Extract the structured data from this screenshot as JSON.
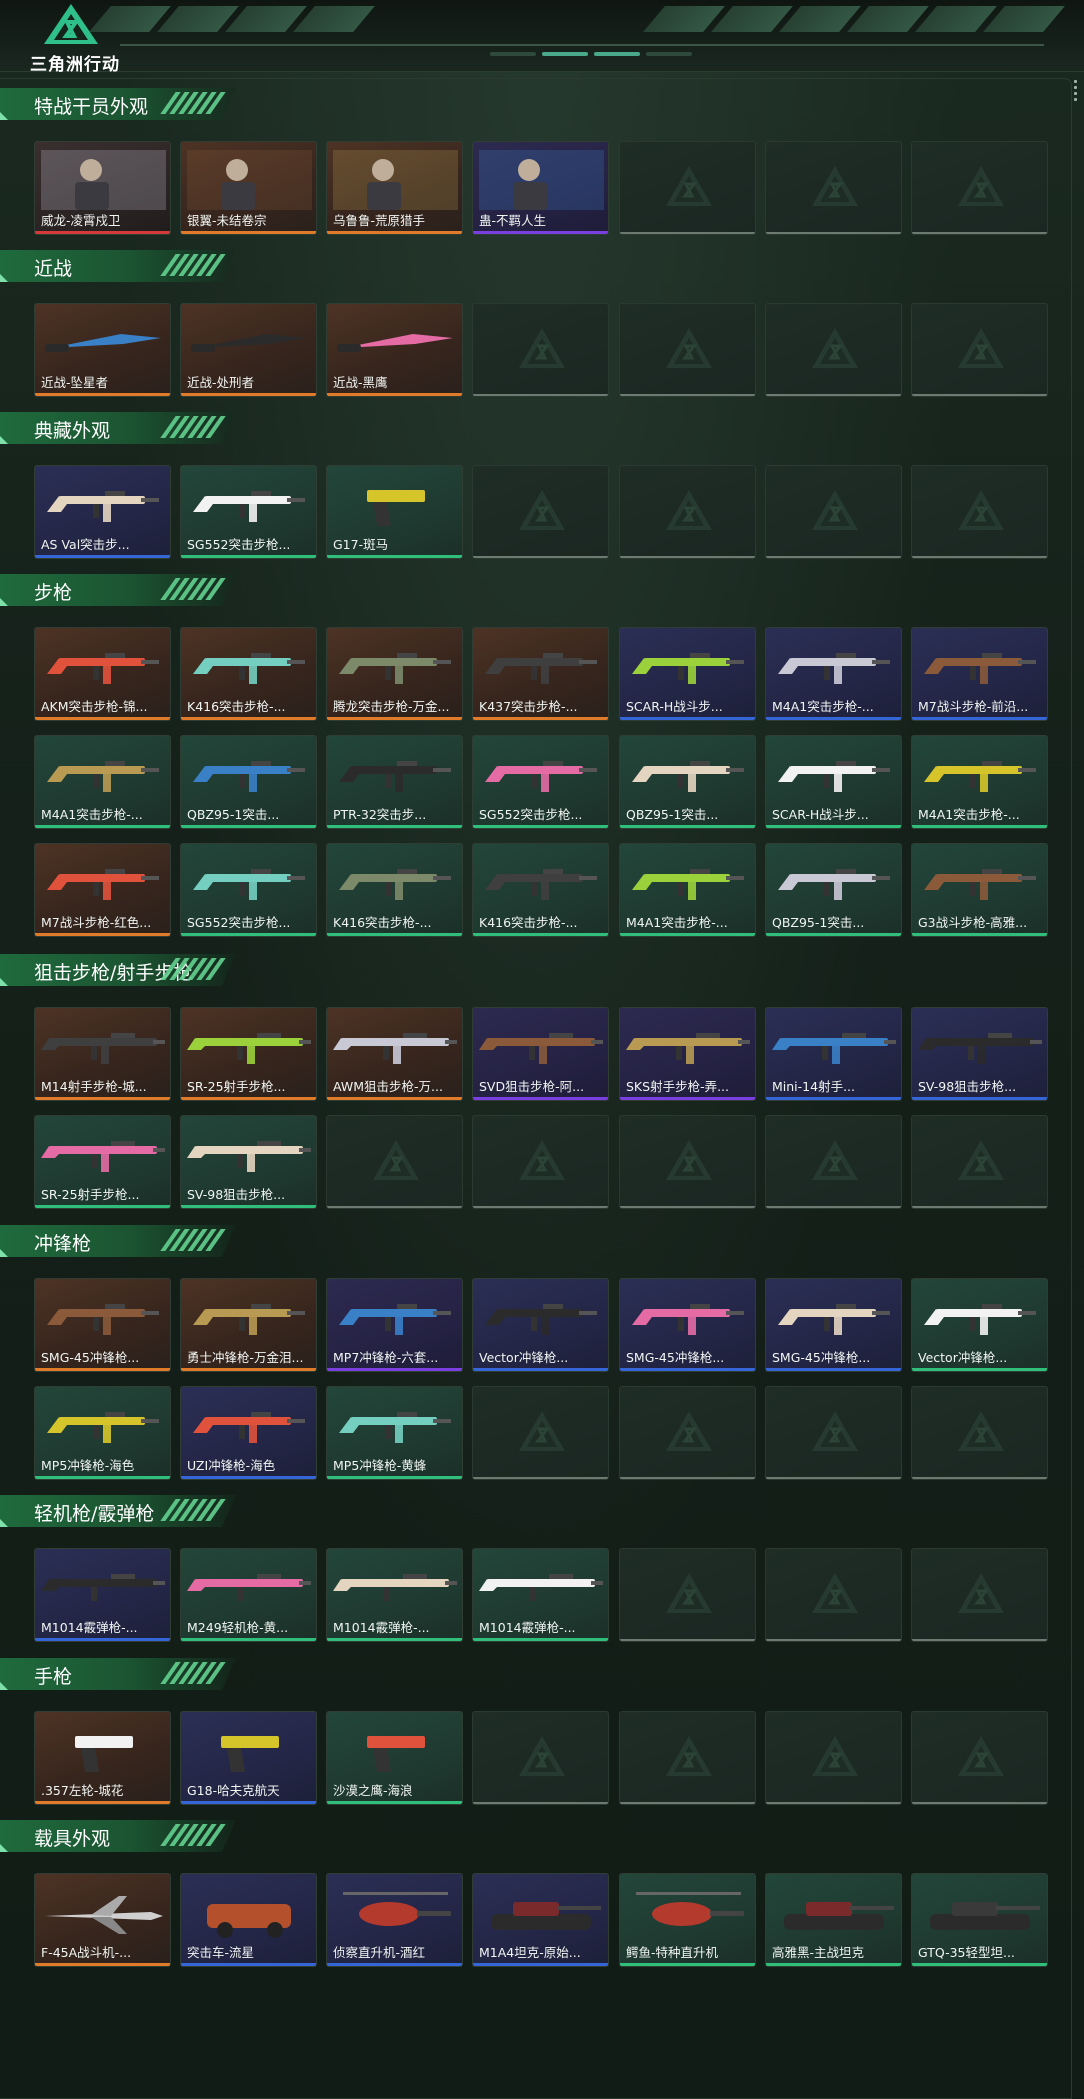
{
  "app": {
    "title": "三角洲行动"
  },
  "icons": {
    "logo": "delta-logo-icon",
    "watermark": "delta-watermark-icon",
    "scroll": "scroll-dots-icon"
  },
  "colors": {
    "rarity_orange": "#e07b2a",
    "rarity_blue": "#3566d8",
    "rarity_green": "#2fbf7a",
    "rarity_red": "#d53a3a",
    "rarity_purple": "#7b3ee0",
    "header_green": "#1f6b3d",
    "background": "#15201a"
  },
  "sections": [
    {
      "title": "特战干员外观",
      "items": [
        {
          "label": "威龙-凌霄戍卫",
          "rarity": "red",
          "kind": "operator"
        },
        {
          "label": "银翼-未结卷宗",
          "rarity": "orange",
          "kind": "operator"
        },
        {
          "label": "乌鲁鲁-荒原猎手",
          "rarity": "orange",
          "kind": "operator"
        },
        {
          "label": "蛊-不羁人生",
          "rarity": "purple",
          "kind": "operator"
        },
        {
          "label": "",
          "rarity": "empty"
        },
        {
          "label": "",
          "rarity": "empty"
        },
        {
          "label": "",
          "rarity": "empty"
        }
      ]
    },
    {
      "title": "近战",
      "items": [
        {
          "label": "近战-坠星者",
          "rarity": "orange",
          "kind": "knife"
        },
        {
          "label": "近战-处刑者",
          "rarity": "orange",
          "kind": "knife"
        },
        {
          "label": "近战-黑鹰",
          "rarity": "orange",
          "kind": "knife"
        },
        {
          "label": "",
          "rarity": "empty"
        },
        {
          "label": "",
          "rarity": "empty"
        },
        {
          "label": "",
          "rarity": "empty"
        },
        {
          "label": "",
          "rarity": "empty"
        }
      ]
    },
    {
      "title": "典藏外观",
      "items": [
        {
          "label": "AS Val突击步...",
          "rarity": "blue",
          "kind": "rifle"
        },
        {
          "label": "SG552突击步枪...",
          "rarity": "green",
          "kind": "rifle"
        },
        {
          "label": "G17-斑马",
          "rarity": "green",
          "kind": "pistol"
        },
        {
          "label": "",
          "rarity": "empty"
        },
        {
          "label": "",
          "rarity": "empty"
        },
        {
          "label": "",
          "rarity": "empty"
        },
        {
          "label": "",
          "rarity": "empty"
        }
      ]
    },
    {
      "title": "步枪",
      "items": [
        {
          "label": "AKM突击步枪-锦...",
          "rarity": "orange",
          "kind": "rifle"
        },
        {
          "label": "K416突击步枪-...",
          "rarity": "orange",
          "kind": "rifle"
        },
        {
          "label": "腾龙突击步枪-万金...",
          "rarity": "orange",
          "kind": "rifle"
        },
        {
          "label": "K437突击步枪-...",
          "rarity": "orange",
          "kind": "rifle"
        },
        {
          "label": "SCAR-H战斗步...",
          "rarity": "blue",
          "kind": "rifle"
        },
        {
          "label": "M4A1突击步枪-...",
          "rarity": "blue",
          "kind": "rifle"
        },
        {
          "label": "M7战斗步枪-前沿...",
          "rarity": "blue",
          "kind": "rifle"
        },
        {
          "label": "M4A1突击步枪-...",
          "rarity": "green",
          "kind": "rifle"
        },
        {
          "label": "QBZ95-1突击...",
          "rarity": "green",
          "kind": "rifle"
        },
        {
          "label": "PTR-32突击步...",
          "rarity": "green",
          "kind": "rifle"
        },
        {
          "label": "SG552突击步枪...",
          "rarity": "green",
          "kind": "rifle"
        },
        {
          "label": "QBZ95-1突击...",
          "rarity": "green",
          "kind": "rifle"
        },
        {
          "label": "SCAR-H战斗步...",
          "rarity": "green",
          "kind": "rifle"
        },
        {
          "label": "M4A1突击步枪-...",
          "rarity": "green",
          "kind": "rifle"
        },
        {
          "label": "M7战斗步枪-红色...",
          "rarity": "orange",
          "kind": "rifle"
        },
        {
          "label": "SG552突击步枪...",
          "rarity": "green",
          "kind": "rifle"
        },
        {
          "label": "K416突击步枪-...",
          "rarity": "green",
          "kind": "rifle"
        },
        {
          "label": "K416突击步枪-...",
          "rarity": "green",
          "kind": "rifle"
        },
        {
          "label": "M4A1突击步枪-...",
          "rarity": "green",
          "kind": "rifle"
        },
        {
          "label": "QBZ95-1突击...",
          "rarity": "green",
          "kind": "rifle"
        },
        {
          "label": "G3战斗步枪-高雅...",
          "rarity": "green",
          "kind": "rifle"
        }
      ]
    },
    {
      "title": "狙击步枪/射手步枪",
      "items": [
        {
          "label": "M14射手步枪-城...",
          "rarity": "orange",
          "kind": "sniper"
        },
        {
          "label": "SR-25射手步枪...",
          "rarity": "orange",
          "kind": "sniper"
        },
        {
          "label": "AWM狙击步枪-万...",
          "rarity": "orange",
          "kind": "sniper"
        },
        {
          "label": "SVD狙击步枪-阿...",
          "rarity": "purple",
          "kind": "sniper"
        },
        {
          "label": "SKS射手步枪-弄...",
          "rarity": "purple",
          "kind": "sniper"
        },
        {
          "label": "Mini-14射手...",
          "rarity": "blue",
          "kind": "sniper"
        },
        {
          "label": "SV-98狙击步枪...",
          "rarity": "blue",
          "kind": "sniper"
        },
        {
          "label": "SR-25射手步枪...",
          "rarity": "green",
          "kind": "sniper"
        },
        {
          "label": "SV-98狙击步枪...",
          "rarity": "green",
          "kind": "sniper"
        },
        {
          "label": "",
          "rarity": "empty"
        },
        {
          "label": "",
          "rarity": "empty"
        },
        {
          "label": "",
          "rarity": "empty"
        },
        {
          "label": "",
          "rarity": "empty"
        },
        {
          "label": "",
          "rarity": "empty"
        }
      ]
    },
    {
      "title": "冲锋枪",
      "items": [
        {
          "label": "SMG-45冲锋枪...",
          "rarity": "orange",
          "kind": "smg"
        },
        {
          "label": "勇士冲锋枪-万金泪...",
          "rarity": "orange",
          "kind": "smg"
        },
        {
          "label": "MP7冲锋枪-六套...",
          "rarity": "purple",
          "kind": "smg"
        },
        {
          "label": "Vector冲锋枪...",
          "rarity": "blue",
          "kind": "smg"
        },
        {
          "label": "SMG-45冲锋枪...",
          "rarity": "blue",
          "kind": "smg"
        },
        {
          "label": "SMG-45冲锋枪...",
          "rarity": "blue",
          "kind": "smg"
        },
        {
          "label": "Vector冲锋枪...",
          "rarity": "green",
          "kind": "smg"
        },
        {
          "label": "MP5冲锋枪-海色",
          "rarity": "green",
          "kind": "smg"
        },
        {
          "label": "UZI冲锋枪-海色",
          "rarity": "blue",
          "kind": "smg"
        },
        {
          "label": "MP5冲锋枪-黄蜂",
          "rarity": "green",
          "kind": "smg"
        },
        {
          "label": "",
          "rarity": "empty"
        },
        {
          "label": "",
          "rarity": "empty"
        },
        {
          "label": "",
          "rarity": "empty"
        },
        {
          "label": "",
          "rarity": "empty"
        }
      ]
    },
    {
      "title": "轻机枪/霰弹枪",
      "items": [
        {
          "label": "M1014霰弹枪-...",
          "rarity": "blue",
          "kind": "shotgun"
        },
        {
          "label": "M249轻机枪-黄...",
          "rarity": "green",
          "kind": "shotgun"
        },
        {
          "label": "M1014霰弹枪-...",
          "rarity": "green",
          "kind": "shotgun"
        },
        {
          "label": "M1014霰弹枪-...",
          "rarity": "green",
          "kind": "shotgun"
        },
        {
          "label": "",
          "rarity": "empty"
        },
        {
          "label": "",
          "rarity": "empty"
        },
        {
          "label": "",
          "rarity": "empty"
        }
      ]
    },
    {
      "title": "手枪",
      "items": [
        {
          "label": ".357左轮-城花",
          "rarity": "orange",
          "kind": "pistol"
        },
        {
          "label": "G18-哈夫克航天",
          "rarity": "blue",
          "kind": "pistol"
        },
        {
          "label": "沙漠之鹰-海浪",
          "rarity": "green",
          "kind": "pistol"
        },
        {
          "label": "",
          "rarity": "empty"
        },
        {
          "label": "",
          "rarity": "empty"
        },
        {
          "label": "",
          "rarity": "empty"
        },
        {
          "label": "",
          "rarity": "empty"
        }
      ]
    },
    {
      "title": "载具外观",
      "items": [
        {
          "label": "F-45A战斗机-...",
          "rarity": "orange",
          "kind": "jet"
        },
        {
          "label": "突击车-流星",
          "rarity": "blue",
          "kind": "car"
        },
        {
          "label": "侦察直升机-酒红",
          "rarity": "blue",
          "kind": "heli"
        },
        {
          "label": "M1A4坦克-原始...",
          "rarity": "blue",
          "kind": "tank"
        },
        {
          "label": "鳄鱼-特种直升机",
          "rarity": "green",
          "kind": "heli"
        },
        {
          "label": "高雅黑-主战坦克",
          "rarity": "green",
          "kind": "tank"
        },
        {
          "label": "GTQ-35轻型坦...",
          "rarity": "green",
          "kind": "tank"
        }
      ]
    }
  ]
}
